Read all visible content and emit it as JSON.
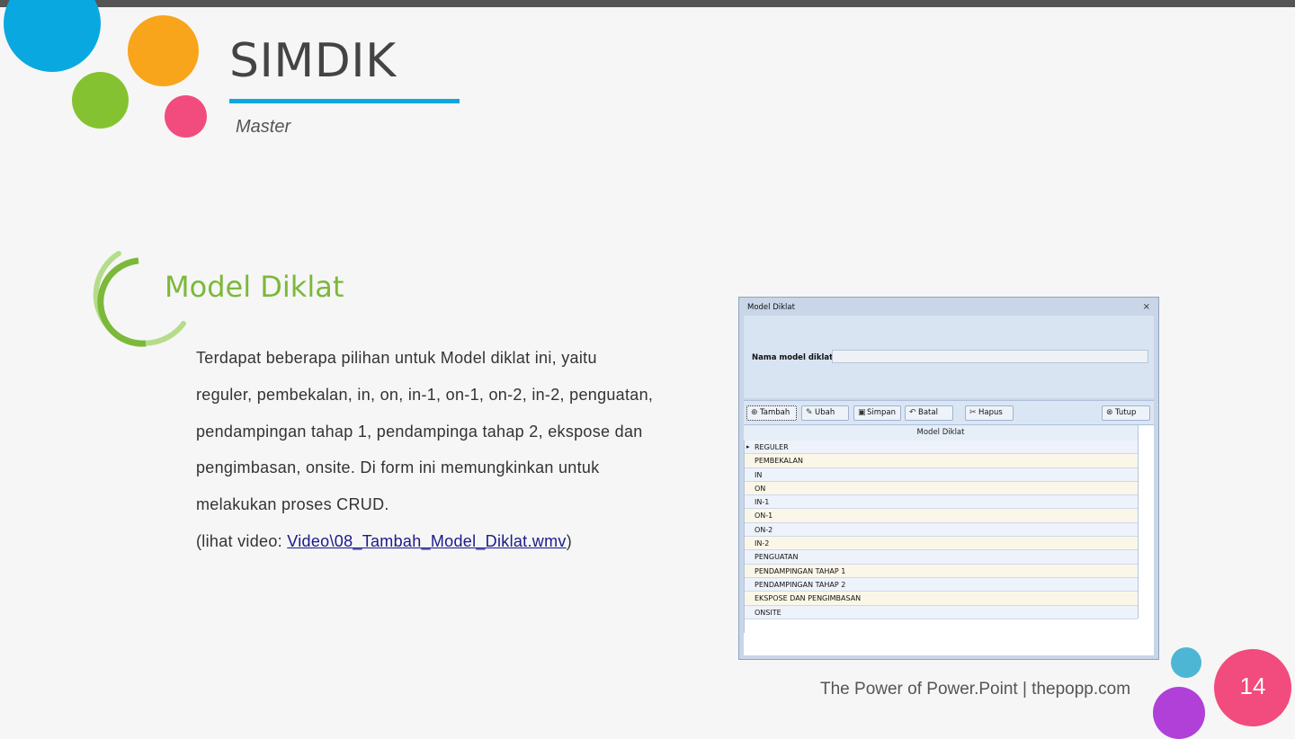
{
  "slide": {
    "title": "SIMDIK",
    "subtitle": "Master",
    "section_title": "Model Diklat",
    "body_lines": [
      "Terdapat beberapa pilihan untuk Model diklat ini, yaitu",
      "reguler, pembekalan, in, on, in-1, on-1, on-2, in-2, penguatan,",
      "pendampingan tahap 1, pendampinga tahap 2, ekspose dan",
      "pengimbasan, onsite. Di form ini memungkinkan untuk",
      "melakukan proses CRUD."
    ],
    "video_prefix": "(lihat video: ",
    "video_link": "Video\\08_Tambah_Model_Diklat.wmv",
    "video_suffix": ")",
    "footer": "The Power of Power.Point | thepopp.com",
    "page_number": "14"
  },
  "window": {
    "title": "Model Diklat",
    "close_glyph": "⨯",
    "field_label": "Nama model diklat:",
    "field_value": "",
    "toolbar": {
      "tambah": "Tambah",
      "ubah": "Ubah",
      "simpan": "Simpan",
      "batal": "Batal",
      "hapus": "Hapus",
      "tutup": "Tutup"
    },
    "grid": {
      "header": "Model Diklat",
      "rows": [
        "REGULER",
        "PEMBEKALAN",
        "IN",
        "ON",
        "IN-1",
        "ON-1",
        "ON-2",
        "IN-2",
        "PENGUATAN",
        "PENDAMPINGAN TAHAP 1",
        "PENDAMPINGAN TAHAP 2",
        "EKSPOSE DAN PENGIMBASAN",
        "ONSITE"
      ]
    }
  },
  "colors": {
    "accent_blue": "#0aa8e0",
    "accent_orange": "#f8a51c",
    "accent_green": "#85c231",
    "accent_pink": "#f24b7d",
    "section_green": "#7cb83a"
  }
}
